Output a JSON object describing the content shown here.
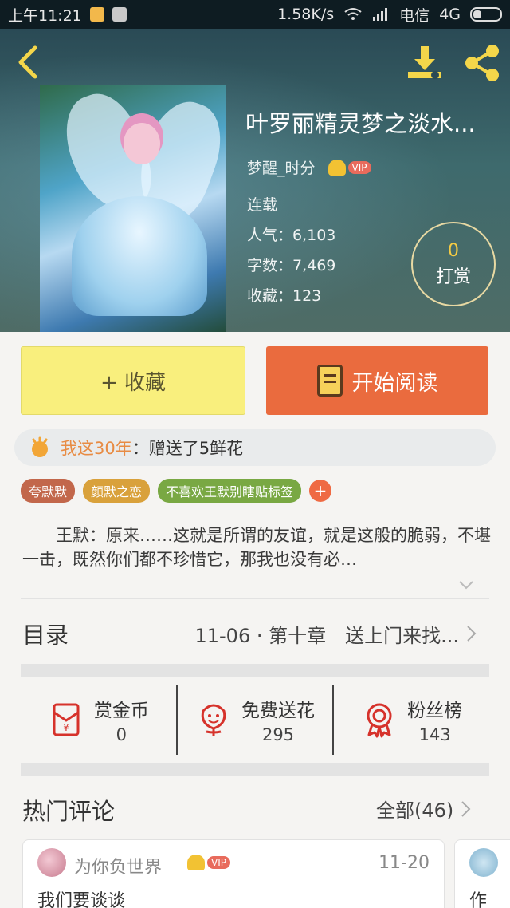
{
  "status_bar": {
    "time": "上午11:21",
    "speed": "1.58K/s",
    "carrier": "电信",
    "network": "4G"
  },
  "book": {
    "title": "叶罗丽精灵梦之淡水...",
    "author": "梦醒_时分",
    "vip_label": "VIP",
    "status": "连载",
    "popularity": "人气：6,103",
    "word_count": "字数：7,469",
    "favorites": "收藏：123"
  },
  "reward": {
    "count": "0",
    "label": "打赏"
  },
  "actions": {
    "favorite_label": "+ 收藏",
    "read_label": "开始阅读"
  },
  "gift_banner": {
    "user": "我这30年",
    "message": "：赠送了5鲜花"
  },
  "tags": [
    {
      "label": "夸默默",
      "color": "#c2674b"
    },
    {
      "label": "颜默之恋",
      "color": "#d9a13b"
    },
    {
      "label": "不喜欢王默别瞎贴标签",
      "color": "#79a843"
    }
  ],
  "tag_add": "+",
  "description": "王默：原来……这就是所谓的友谊，就是这般的脆弱，不堪一击，既然你们都不珍惜它，那我也没有必…",
  "toc": {
    "label": "目录",
    "latest": "11-06 · 第十章　送上门来找..."
  },
  "stats": [
    {
      "name": "赏金币",
      "value": "0",
      "icon": "red-envelope-icon"
    },
    {
      "name": "免费送花",
      "value": "295",
      "icon": "flower-icon"
    },
    {
      "name": "粉丝榜",
      "value": "143",
      "icon": "medal-icon"
    }
  ],
  "hot_comments": {
    "title": "热门评论",
    "all_label": "全部(46)",
    "items": [
      {
        "user": "为你负世界",
        "vip": "VIP",
        "date": "11-20",
        "text": "我们要谈谈"
      },
      {
        "text": "作"
      }
    ]
  },
  "colors": {
    "accent_orange": "#ea6b3e",
    "favorite_yellow": "#f9ef7d",
    "reward_gold": "#f5cb43"
  }
}
